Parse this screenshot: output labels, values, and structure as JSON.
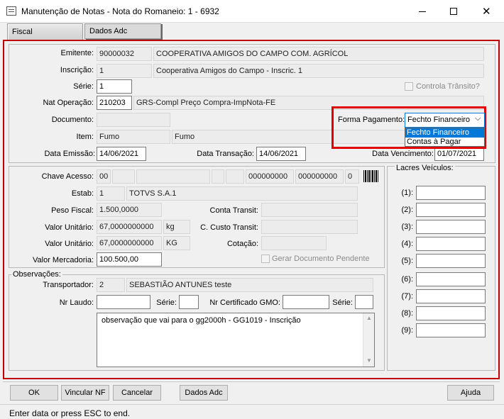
{
  "window": {
    "title": "Manutenção de Notas - Nota do Romaneio: 1 - 6932"
  },
  "tabs": [
    "Fiscal",
    "Dados Adc"
  ],
  "header": {
    "emitente_label": "Emitente:",
    "emitente_code": "90000032",
    "emitente_name": "COOPERATIVA AMIGOS DO CAMPO COM. AGRÍCOL",
    "inscricao_label": "Inscrição:",
    "inscricao_code": "1",
    "inscricao_name": "Cooperativa Amigos do Campo - Inscric. 1",
    "serie_label": "Série:",
    "serie_value": "1",
    "controla_transito_label": "Controla Trânsito?",
    "natop_label": "Nat Operação:",
    "natop_code": "210203",
    "natop_name": "GRS-Compl Preço Compra-ImpNota-FE",
    "documento_label": "Documento:",
    "documento_value": "",
    "forma_pagamento_label": "Forma Pagamento:",
    "forma_pagamento_value": "Fechto Financeiro",
    "forma_pagamento_options": [
      "Fechto Financeiro",
      "Contas à Pagar"
    ],
    "item_label": "Item:",
    "item_code": "Fumo",
    "item_name": "Fumo",
    "data_emissao_label": "Data Emissão:",
    "data_emissao": "14/06/2021",
    "data_transacao_label": "Data Transação:",
    "data_transacao": "14/06/2021",
    "data_vencimento_label": "Data Vencimento:",
    "data_vencimento": "01/07/2021"
  },
  "values": {
    "chave_label": "Chave Acesso:",
    "chave_f1": "00",
    "chave_f2": "000000000",
    "chave_f3": "000000000",
    "chave_f4": "0",
    "estab_label": "Estab:",
    "estab_code": "1",
    "estab_name": "TOTVS S.A.1",
    "peso_label": "Peso Fiscal:",
    "peso_value": "1.500,0000",
    "conta_transit_label": "Conta Transit:",
    "vu1_label": "Valor Unitário:",
    "vu1_value": "67,0000000000",
    "vu1_unit": "kg",
    "ccusto_label": "C. Custo Transit:",
    "vu2_label": "Valor Unitário:",
    "vu2_value": "67,0000000000",
    "vu2_unit": "KG",
    "cotacao_label": "Cotação:",
    "vm_label": "Valor Mercadoria:",
    "vm_value": "100.500,00",
    "gerar_doc_label": "Gerar Documento Pendente"
  },
  "lacres": {
    "title": "Lacres Veículos:",
    "labels": [
      "(1):",
      "(2):",
      "(3):",
      "(4):",
      "(5):",
      "(6):",
      "(7):",
      "(8):",
      "(9):"
    ]
  },
  "observacoes": {
    "title": "Observações:",
    "transportador_label": "Transportador:",
    "transportador_code": "2",
    "transportador_name": "SEBASTIÃO ANTUNES teste",
    "nr_laudo_label": "Nr Laudo:",
    "serie_label": "Série:",
    "nr_cert_label": "Nr Certificado GMO:",
    "serie2_label": "Série:",
    "text": "observação que vai para o gg2000h - GG1019 - Inscrição"
  },
  "buttons": {
    "ok": "OK",
    "vincular": "Vincular NF",
    "cancelar": "Cancelar",
    "dados_adc": "Dados Adc",
    "ajuda": "Ajuda"
  },
  "status_bar": "Enter data or press ESC to end.",
  "colors": {
    "highlight_red": "#e00000",
    "selection_blue": "#0078d7"
  }
}
